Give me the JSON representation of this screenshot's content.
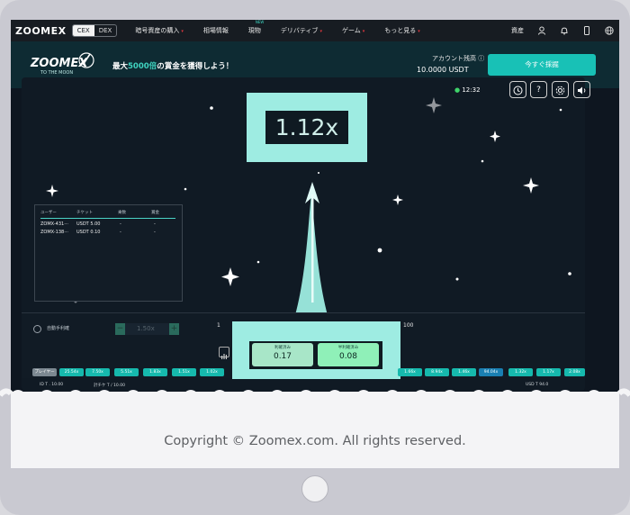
{
  "nav": {
    "logo": "ZOOMEX",
    "segment": [
      "CEX",
      "DEX"
    ],
    "menu": [
      {
        "label": "暗号資産の購入",
        "dot": "▾"
      },
      {
        "label": "相場情報",
        "dot": ""
      },
      {
        "label": "現物",
        "dot": "",
        "badge": "NEW"
      },
      {
        "label": "デリバティブ",
        "dot": "▾"
      },
      {
        "label": "ゲーム",
        "dot": "▾"
      },
      {
        "label": "もっと見る",
        "dot": "▾"
      }
    ],
    "assets_label": "資産"
  },
  "banner": {
    "logo": "ZOOMEX",
    "logo_sub": "TO THE MOON",
    "promo_prefix": "最大",
    "promo_highlight": "5000倍",
    "promo_suffix": "の賞金を獲得しよう！",
    "balance_label": "アカウント残高 ⓘ",
    "balance_value": "10.0000 USDT",
    "join_button": "今すぐ採掘"
  },
  "game": {
    "time": "12:32",
    "wifi_icon": "●",
    "buttons": [
      "history-icon",
      "help-icon",
      "settings-icon",
      "sound-icon"
    ],
    "multiplier": "1.12x"
  },
  "table": {
    "headers": [
      "ユーザー",
      "チケット",
      "乗数",
      "賞金"
    ],
    "rows": [
      {
        "user": "ZOMX-431···",
        "ticket": "USDT 5.00",
        "mult": "-",
        "prize": "-"
      },
      {
        "user": "ZOMX-138···",
        "ticket": "USDT 0.10",
        "mult": "-",
        "prize": "-"
      }
    ]
  },
  "controls": {
    "auto_label": "自動手利確",
    "stepper_value": "1.50x",
    "minus": "−",
    "plus": "+",
    "range_min": "1",
    "range_max": "100",
    "cash_left_label": "利確済み",
    "cash_left_value": "0.17",
    "cash_right_label": "半利確済み",
    "cash_right_value": "0.08"
  },
  "ticker": {
    "label": "プレイヤー",
    "left": [
      "25.54x",
      "7.50x",
      "5.51x",
      "1.83x",
      "1.51x",
      "1.02x"
    ],
    "right": [
      "1.66x",
      "8.94x",
      "1.46x",
      "94.04x",
      "1.32x",
      "1.17x",
      "2.08x"
    ],
    "blue_index_right": 3
  },
  "under": {
    "left": "ID T . 10.00",
    "mid": "計チケ T / 10.00",
    "right": "USD T 94.0"
  },
  "footer": {
    "copyright": "Copyright © Zoomex.com. All rights reserved."
  },
  "colors": {
    "accent": "#18c1b6",
    "frame": "#9eece2",
    "bg": "#0e1620"
  }
}
